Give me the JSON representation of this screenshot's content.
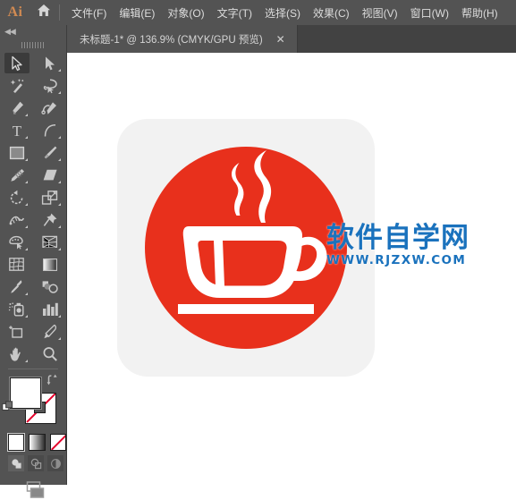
{
  "app": {
    "logo": "Ai",
    "home_icon": "home-icon"
  },
  "menubar": {
    "items": [
      {
        "label": "文件(F)"
      },
      {
        "label": "编辑(E)"
      },
      {
        "label": "对象(O)"
      },
      {
        "label": "文字(T)"
      },
      {
        "label": "选择(S)"
      },
      {
        "label": "效果(C)"
      },
      {
        "label": "视图(V)"
      },
      {
        "label": "窗口(W)"
      },
      {
        "label": "帮助(H)"
      }
    ]
  },
  "tabbar": {
    "document": {
      "title": "未标题-1* @ 136.9% (CMYK/GPU 预览)",
      "close_label": "✕"
    }
  },
  "toolbar": {
    "collapse_label": "◀◀",
    "tools": [
      {
        "name": "selection-tool",
        "icon": "arrow-solid-outline",
        "active": true,
        "corner": false
      },
      {
        "name": "direct-selection-tool",
        "icon": "arrow-filled",
        "active": false,
        "corner": true
      },
      {
        "name": "magic-wand-tool",
        "icon": "magic-wand",
        "active": false,
        "corner": false
      },
      {
        "name": "lasso-tool",
        "icon": "lasso",
        "active": false,
        "corner": true
      },
      {
        "name": "pen-tool",
        "icon": "pen",
        "active": false,
        "corner": true
      },
      {
        "name": "curvature-tool",
        "icon": "curvature-pen",
        "active": false,
        "corner": false
      },
      {
        "name": "type-tool",
        "icon": "type-T",
        "active": false,
        "corner": true
      },
      {
        "name": "line-segment-tool",
        "icon": "arc-line",
        "active": false,
        "corner": true
      },
      {
        "name": "rectangle-tool",
        "icon": "rectangle",
        "active": false,
        "corner": true
      },
      {
        "name": "paintbrush-tool",
        "icon": "paintbrush",
        "active": false,
        "corner": true
      },
      {
        "name": "shaper-tool",
        "icon": "shaper-pencil",
        "active": false,
        "corner": true
      },
      {
        "name": "eraser-tool",
        "icon": "eraser",
        "active": false,
        "corner": true
      },
      {
        "name": "rotate-tool",
        "icon": "rotate",
        "active": false,
        "corner": true
      },
      {
        "name": "scale-tool",
        "icon": "scale",
        "active": false,
        "corner": true
      },
      {
        "name": "width-tool",
        "icon": "width",
        "active": false,
        "corner": true
      },
      {
        "name": "free-transform-tool",
        "icon": "pushpin",
        "active": false,
        "corner": true
      },
      {
        "name": "shape-builder-tool",
        "icon": "shape-builder",
        "active": false,
        "corner": true
      },
      {
        "name": "perspective-grid-tool",
        "icon": "perspective-grid",
        "active": false,
        "corner": true
      },
      {
        "name": "mesh-tool",
        "icon": "mesh",
        "active": false,
        "corner": false
      },
      {
        "name": "gradient-tool",
        "icon": "gradient",
        "active": false,
        "corner": false
      },
      {
        "name": "eyedropper-tool",
        "icon": "eyedropper",
        "active": false,
        "corner": true
      },
      {
        "name": "blend-tool",
        "icon": "blend",
        "active": false,
        "corner": false
      },
      {
        "name": "symbol-sprayer-tool",
        "icon": "symbol-sprayer",
        "active": false,
        "corner": true
      },
      {
        "name": "column-graph-tool",
        "icon": "bar-chart",
        "active": false,
        "corner": true
      },
      {
        "name": "artboard-tool",
        "icon": "artboard",
        "active": false,
        "corner": false
      },
      {
        "name": "slice-tool",
        "icon": "slice-knife",
        "active": false,
        "corner": true
      },
      {
        "name": "hand-tool",
        "icon": "hand",
        "active": false,
        "corner": true
      },
      {
        "name": "zoom-tool",
        "icon": "magnifier",
        "active": false,
        "corner": false
      }
    ],
    "colors": {
      "fill": "#ffffff",
      "stroke": "#ffffff",
      "stroke_is_none": true,
      "none_slash_color": "#e4002b",
      "fill_swatch_name": "fill-color-swatch",
      "stroke_swatch_name": "stroke-color-swatch",
      "swap_icon": "swap-fill-stroke-icon",
      "default_icon": "default-fill-stroke-icon"
    },
    "paint_modes": [
      {
        "name": "color-mode",
        "selected": true
      },
      {
        "name": "gradient-mode",
        "selected": false
      },
      {
        "name": "none-mode",
        "selected": false
      }
    ],
    "draw_modes": [
      {
        "name": "draw-normal",
        "selected": true
      },
      {
        "name": "draw-behind",
        "selected": false
      },
      {
        "name": "draw-inside",
        "selected": false
      }
    ],
    "screen_mode": {
      "name": "change-screen-mode"
    }
  },
  "canvas": {
    "artwork": {
      "name": "coffee-cup-icon",
      "background_color": "#f2f2f2",
      "circle_color": "#e8301c",
      "cup_color": "#ffffff",
      "corner_radius": "34px"
    },
    "watermark": {
      "brand": "软件自学网",
      "url": "WWW.RJZXW.COM",
      "color": "#1a72bd"
    }
  }
}
